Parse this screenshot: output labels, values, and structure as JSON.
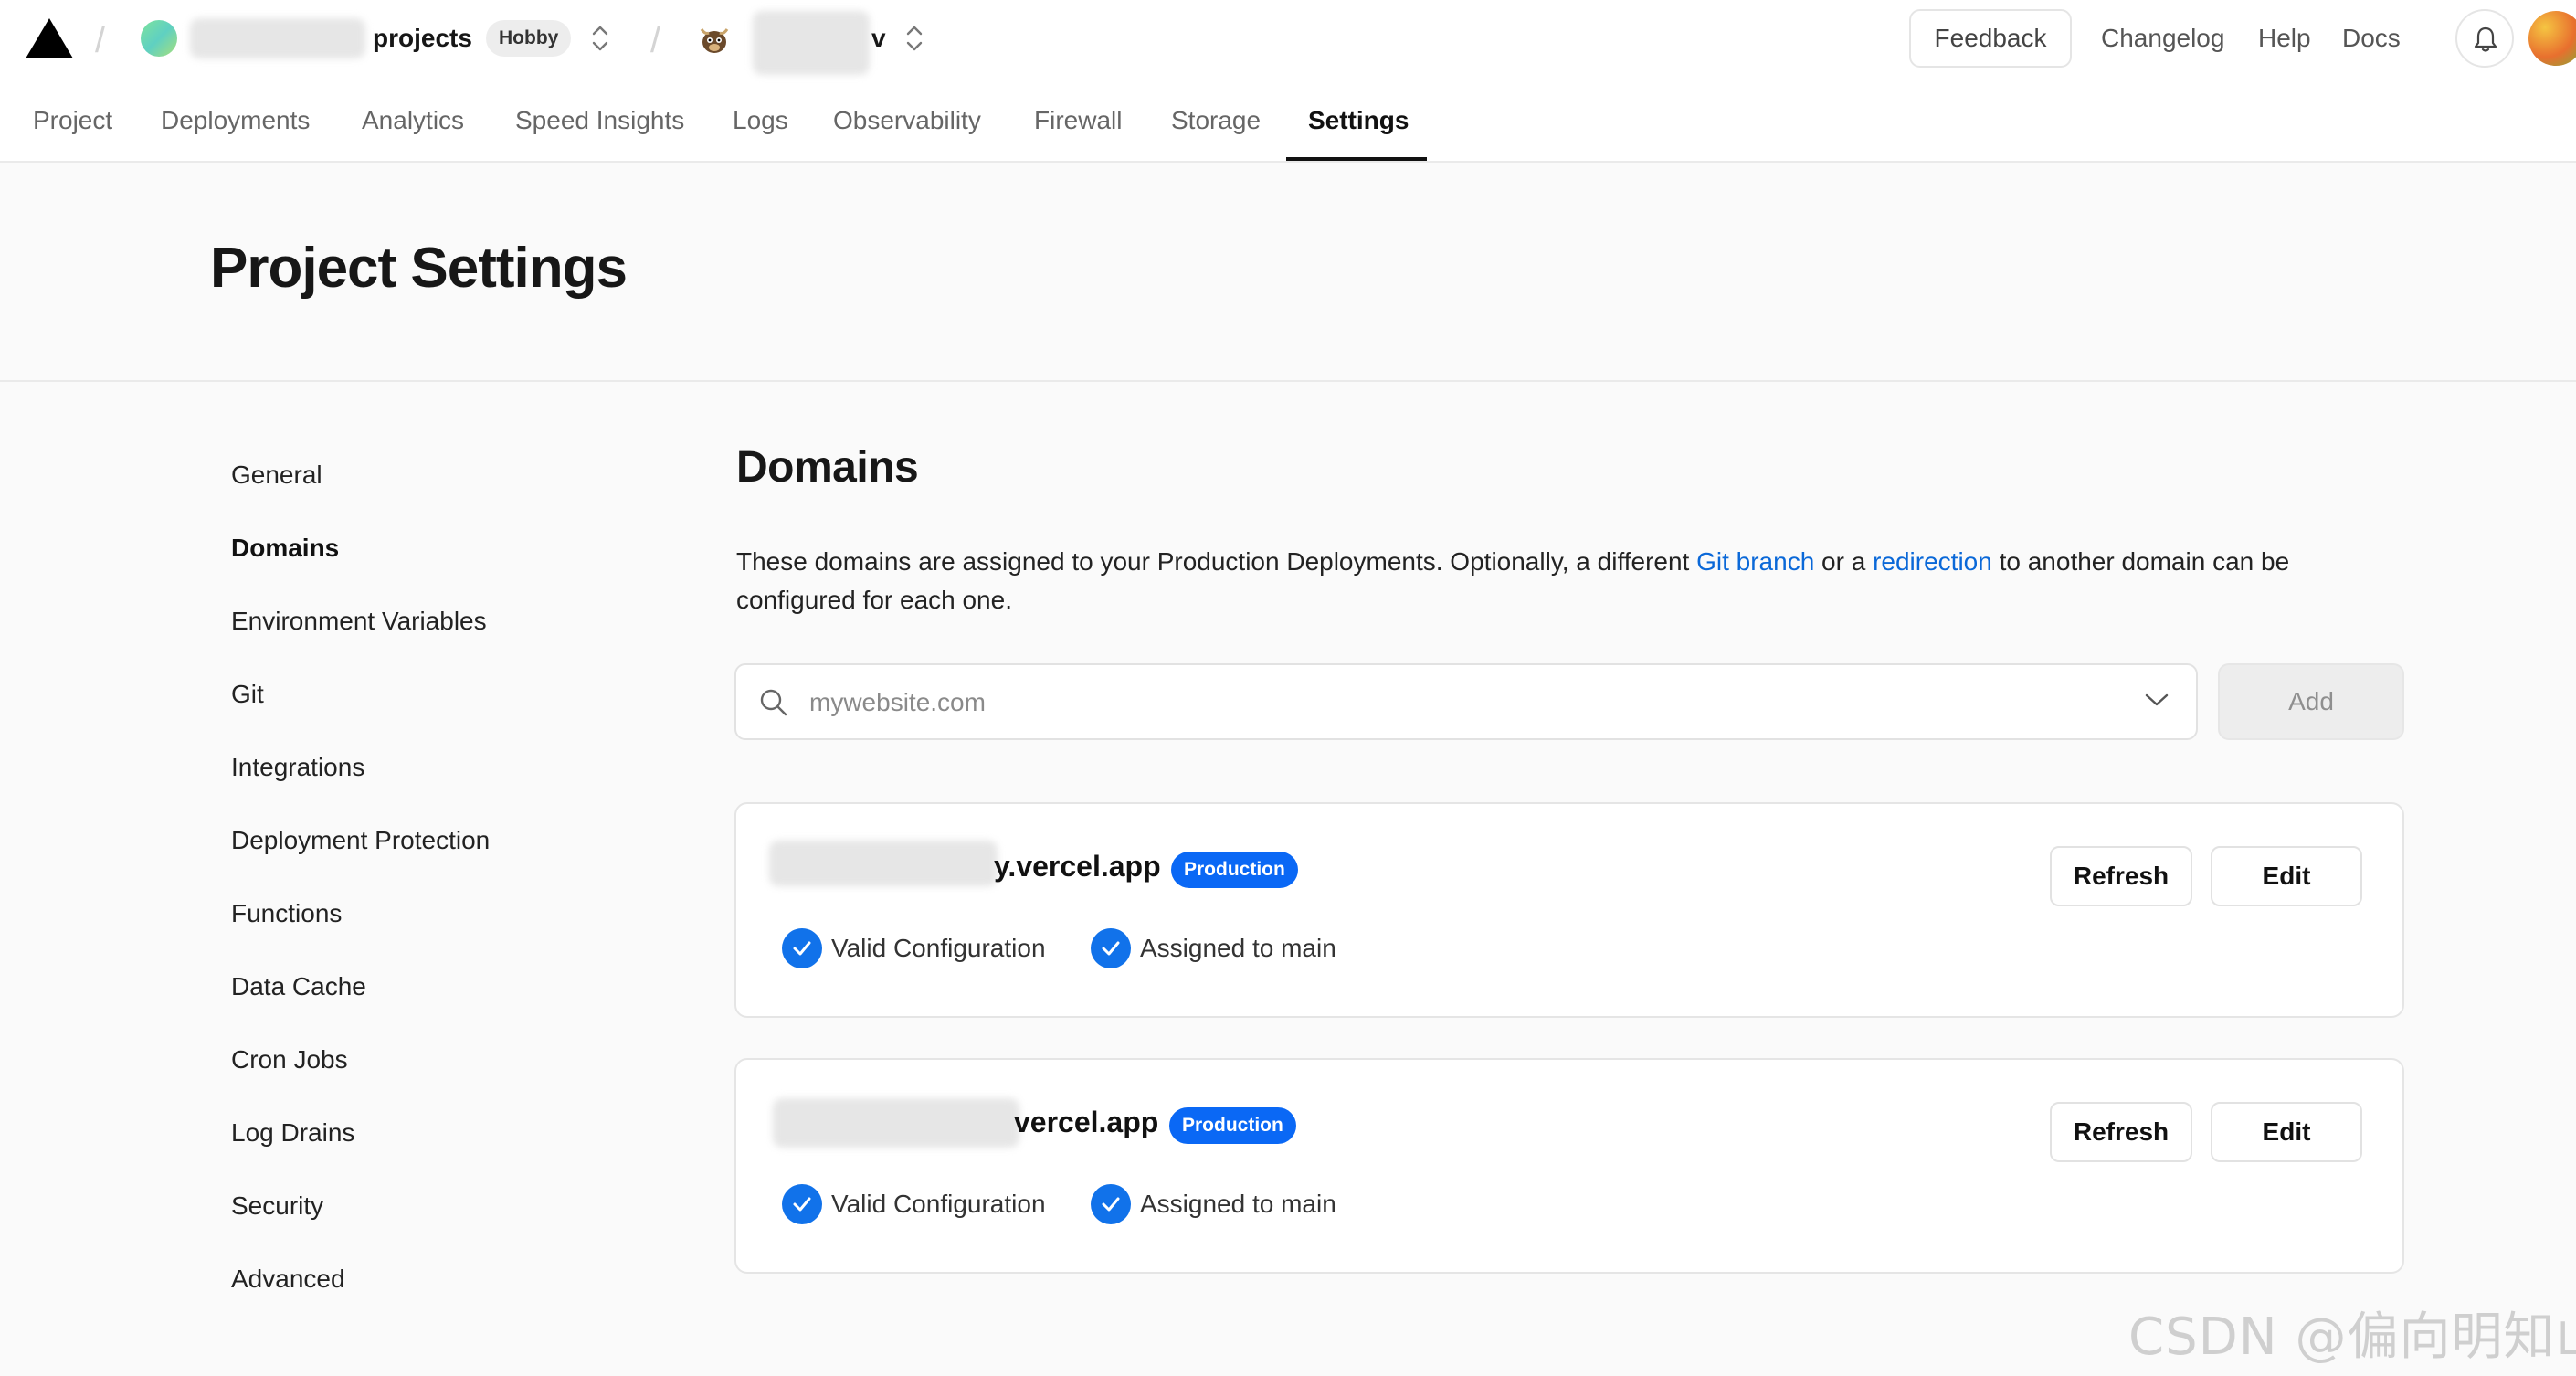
{
  "header": {
    "team_name": "projects",
    "plan_badge": "Hobby",
    "project_name_tail": "v",
    "feedback_label": "Feedback",
    "links": [
      "Changelog",
      "Help",
      "Docs"
    ]
  },
  "tabs": [
    {
      "label": "Project"
    },
    {
      "label": "Deployments"
    },
    {
      "label": "Analytics"
    },
    {
      "label": "Speed Insights"
    },
    {
      "label": "Logs"
    },
    {
      "label": "Observability"
    },
    {
      "label": "Firewall"
    },
    {
      "label": "Storage"
    },
    {
      "label": "Settings",
      "active": true
    }
  ],
  "page_title": "Project Settings",
  "sidebar": {
    "items": [
      "General",
      "Domains",
      "Environment Variables",
      "Git",
      "Integrations",
      "Deployment Protection",
      "Functions",
      "Data Cache",
      "Cron Jobs",
      "Log Drains",
      "Security",
      "Advanced"
    ],
    "active": "Domains"
  },
  "domains": {
    "title": "Domains",
    "description": {
      "part1": "These domains are assigned to your Production Deployments. Optionally, a different ",
      "link1": "Git branch",
      "part2": " or a ",
      "link2": "redirection",
      "part3": " to another domain can be configured for each one."
    },
    "search_placeholder": "mywebsite.com",
    "add_label": "Add",
    "cards": [
      {
        "domain_suffix": "y.vercel.app",
        "badge": "Production",
        "status_valid": "Valid Configuration",
        "status_assigned": "Assigned to main",
        "refresh_label": "Refresh",
        "edit_label": "Edit"
      },
      {
        "domain_suffix": "vercel.app",
        "badge": "Production",
        "status_valid": "Valid Configuration",
        "status_assigned": "Assigned to main",
        "refresh_label": "Refresh",
        "edit_label": "Edit"
      }
    ]
  },
  "watermark": "CSDN @偏向明知山",
  "colors": {
    "accent": "#0a68f5",
    "link": "#0a68d8",
    "check": "#1172ea"
  }
}
